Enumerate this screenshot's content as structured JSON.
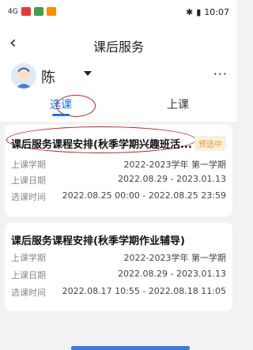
{
  "status_bar": {
    "time": "10:07",
    "signal": "4G",
    "battery_icon": "battery-icon"
  },
  "header": {
    "back_icon": "‹",
    "title": "课后服务"
  },
  "user": {
    "name": "陈",
    "more_icon": "···"
  },
  "tabs": [
    {
      "label": "选课",
      "active": true
    },
    {
      "label": "上课",
      "active": false
    }
  ],
  "cards": [
    {
      "title": "课后服务课程安排(秋季学期兴趣班活...",
      "badge": "预选中",
      "rows": [
        {
          "label": "上课学期",
          "value": "2022-2023学年 第一学期"
        },
        {
          "label": "上课日期",
          "value": "2022.08.29 - 2023.01.13"
        },
        {
          "label": "选课时间",
          "value": "2022.08.25 00:00 - 2022.08.25 23:59"
        }
      ]
    },
    {
      "title": "课后服务课程安排(秋季学期作业辅导)",
      "rows": [
        {
          "label": "上课学期",
          "value": "2022-2023学年 第一学期"
        },
        {
          "label": "上课日期",
          "value": "2022.08.29 - 2023.01.13"
        },
        {
          "label": "选课时间",
          "value": "2022.08.17 10:55 - 2022.08.18 11:05"
        }
      ]
    }
  ],
  "colors": {
    "accent": "#1a73e8",
    "badge_text": "#e59b2e",
    "badge_bg": "#fdf0d8",
    "annotation": "#b22222"
  }
}
